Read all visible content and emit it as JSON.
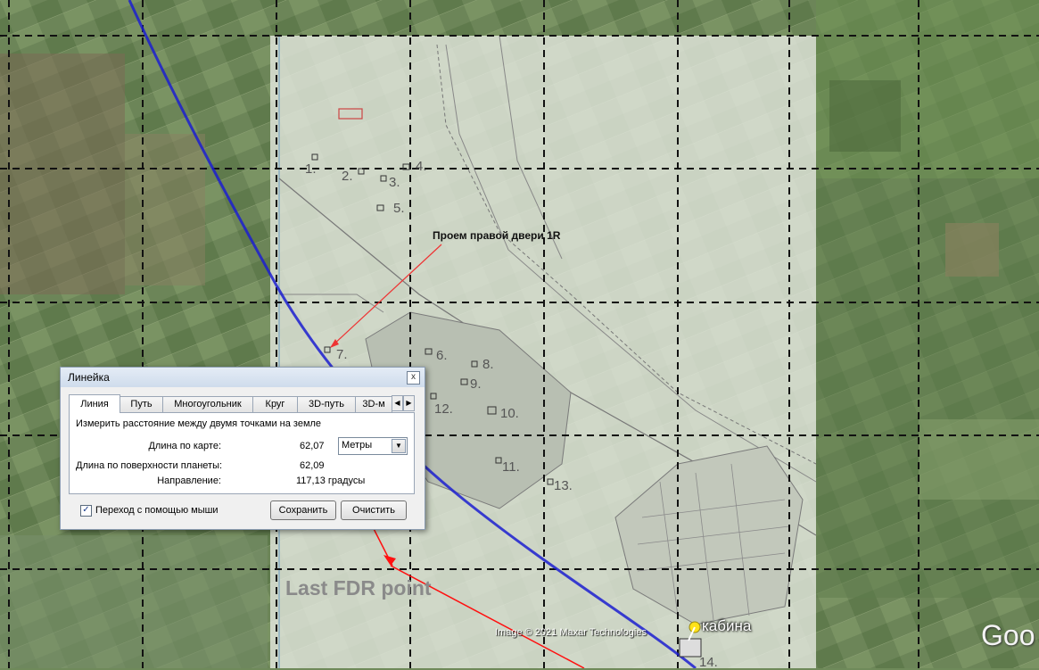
{
  "map": {
    "parcel_labels": [
      "1.",
      "2.",
      "3.",
      "4.",
      "5.",
      "6.",
      "7.",
      "8.",
      "9.",
      "10.",
      "11.",
      "12.",
      "13.",
      "14."
    ],
    "annotation": "Проем правой двери 1R",
    "fdr_label": "Last FDR point",
    "placemark_label": "кабина",
    "copyright": "Image © 2021 Maxar Technologies",
    "logo": "Goo",
    "colors": {
      "track": "#1c1fd0",
      "measure_line": "#ff1010",
      "placemark": "#ffe21a"
    }
  },
  "ruler": {
    "title": "Линейка",
    "close": "x",
    "tabs": [
      "Линия",
      "Путь",
      "Многоугольник",
      "Круг",
      "3D-путь",
      "3D-м"
    ],
    "active_tab": "Линия",
    "tab_prev": "◀",
    "tab_next": "▶",
    "description": "Измерить расстояние между двумя точками на земле",
    "map_length_label": "Длина по карте:",
    "map_length_value": "62,07",
    "unit": "Метры",
    "unit_arrow": "▼",
    "ground_length_label": "Длина по поверхности планеты:",
    "ground_length_value": "62,09",
    "heading_label": "Направление:",
    "heading_value": "117,13 градусы",
    "mouse_nav_label": "Переход с помощью мыши",
    "mouse_nav_checked": true,
    "check_mark": "✓",
    "save": "Сохранить",
    "clear": "Очистить"
  }
}
